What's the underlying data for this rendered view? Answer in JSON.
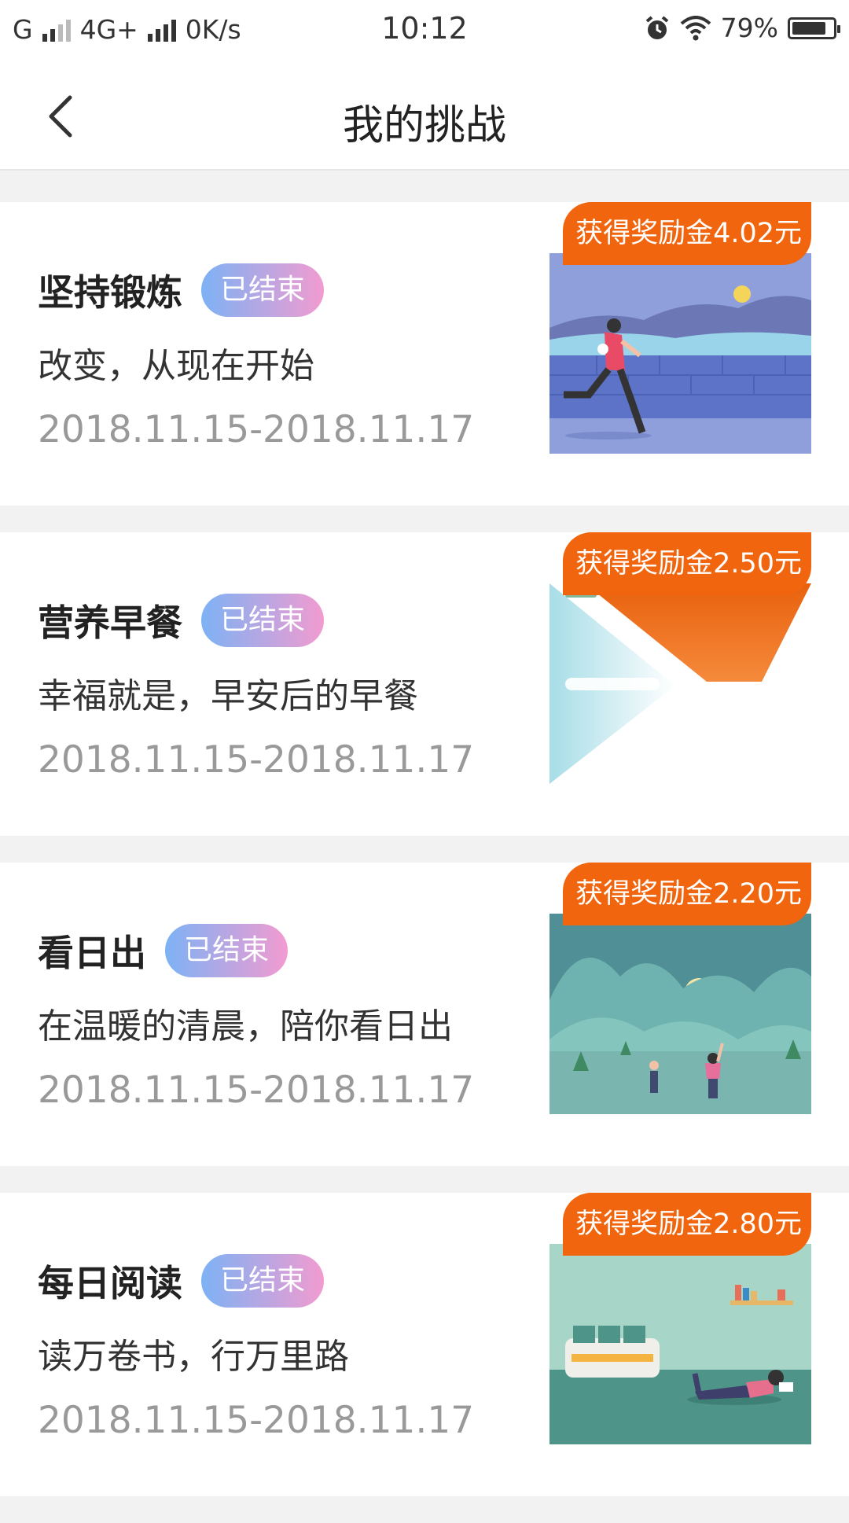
{
  "status_bar": {
    "carrier": "G",
    "network": "4G+",
    "speed": "0K/s",
    "time": "10:12",
    "battery": "79%"
  },
  "nav": {
    "title": "我的挑战",
    "back_icon": "chevron-left-icon"
  },
  "challenges": [
    {
      "title": "坚持锻炼",
      "status": "已结束",
      "description": "改变，从现在开始",
      "date_range": "2018.11.15-2018.11.17",
      "reward": "获得奖励金4.02元"
    },
    {
      "title": "营养早餐",
      "status": "已结束",
      "description": "幸福就是，早安后的早餐",
      "date_range": "2018.11.15-2018.11.17",
      "reward": "获得奖励金2.50元"
    },
    {
      "title": "看日出",
      "status": "已结束",
      "description": "在温暖的清晨，陪你看日出",
      "date_range": "2018.11.15-2018.11.17",
      "reward": "获得奖励金2.20元"
    },
    {
      "title": "每日阅读",
      "status": "已结束",
      "description": "读万卷书，行万里路",
      "date_range": "2018.11.15-2018.11.17",
      "reward": "获得奖励金2.80元"
    }
  ],
  "colors": {
    "reward_bg": "#f0650d",
    "badge_gradient_start": "#7db2f5",
    "badge_gradient_end": "#f29bd0",
    "date_text": "#999999"
  }
}
